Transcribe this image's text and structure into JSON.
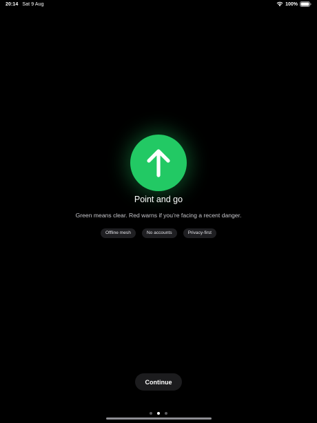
{
  "status_bar": {
    "time": "20:14",
    "date": "Sat 9 Aug",
    "battery_percent_label": "100%",
    "battery_level": 1.0,
    "icons": [
      "wifi-icon",
      "battery-icon"
    ]
  },
  "hero": {
    "icon": "arrow-up-icon",
    "color": "#22c964"
  },
  "onboarding": {
    "title": "Point and go",
    "subtitle": "Green means clear. Red warns if you’re facing a recent danger.",
    "chips": [
      "Offline mesh",
      "No accounts",
      "Privacy-first"
    ]
  },
  "actions": {
    "continue_label": "Continue"
  },
  "pager": {
    "total_pages": 3,
    "current_page": 2
  }
}
